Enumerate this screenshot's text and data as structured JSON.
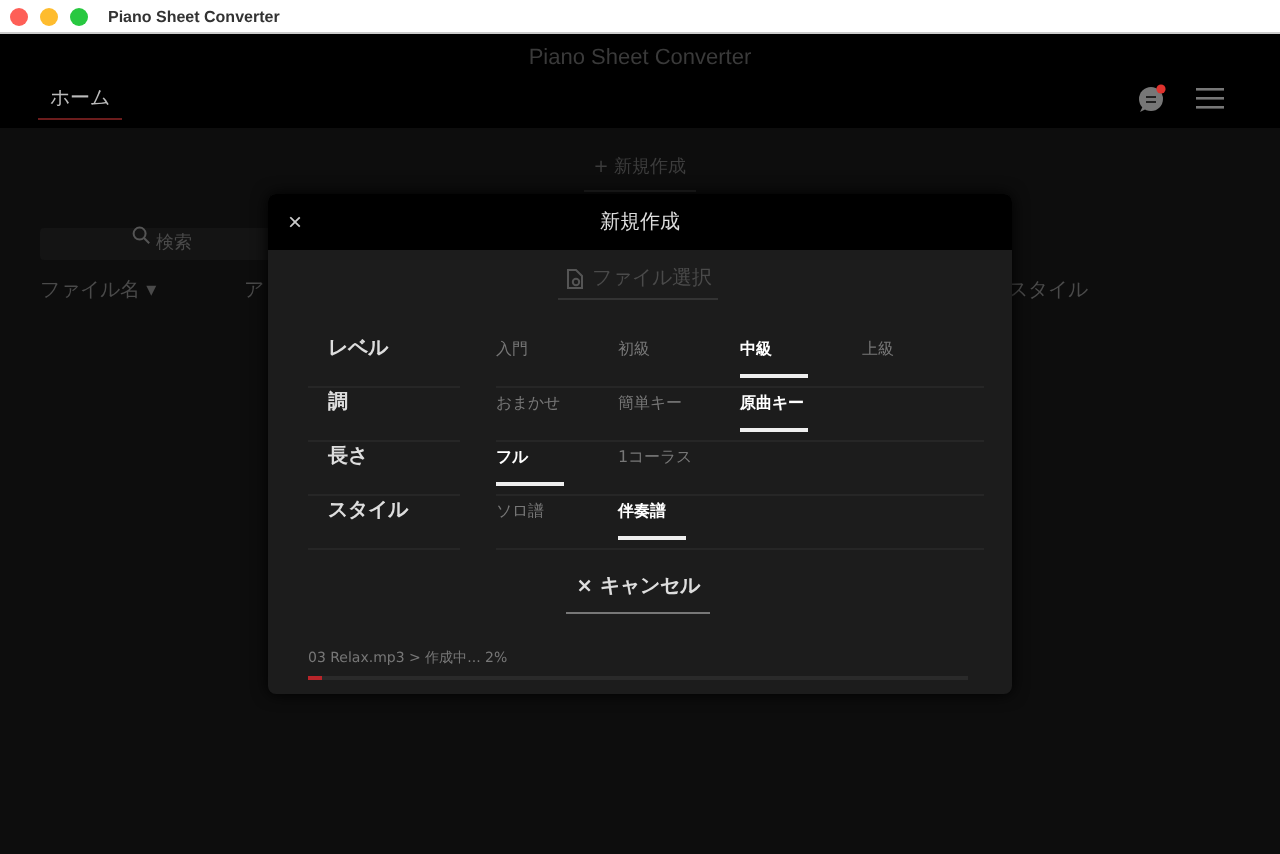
{
  "window": {
    "title": "Piano Sheet Converter"
  },
  "app": {
    "title": "Piano Sheet Converter",
    "tabs": [
      {
        "label": "ホーム",
        "selected": true
      }
    ],
    "notification": true
  },
  "home": {
    "new_button": "+ 新規作成",
    "search": {
      "placeholder": "検索"
    },
    "columns": [
      {
        "label": "ファイル名 ▾"
      },
      {
        "label": "ア"
      },
      {
        "label": "スタイル"
      }
    ]
  },
  "dialog": {
    "title": "新規作成",
    "close": "×",
    "file_button": "ファイル選択",
    "settings": [
      {
        "label": "レベル",
        "options": [
          {
            "label": "入門",
            "selected": false
          },
          {
            "label": "初級",
            "selected": false
          },
          {
            "label": "中級",
            "selected": true
          },
          {
            "label": "上級",
            "selected": false
          }
        ]
      },
      {
        "label": "調",
        "options": [
          {
            "label": "おまかせ",
            "selected": false
          },
          {
            "label": "簡単キー",
            "selected": false
          },
          {
            "label": "原曲キー",
            "selected": true
          }
        ]
      },
      {
        "label": "長さ",
        "options": [
          {
            "label": "フル",
            "selected": true
          },
          {
            "label": "1コーラス",
            "selected": false
          }
        ]
      },
      {
        "label": "スタイル",
        "options": [
          {
            "label": "ソロ譜",
            "selected": false
          },
          {
            "label": "伴奏譜",
            "selected": true
          }
        ]
      }
    ],
    "cancel": "× キャンセル",
    "progress": {
      "text": "03 Relax.mp3 > 作成中... 2%",
      "level": 0.02
    }
  }
}
